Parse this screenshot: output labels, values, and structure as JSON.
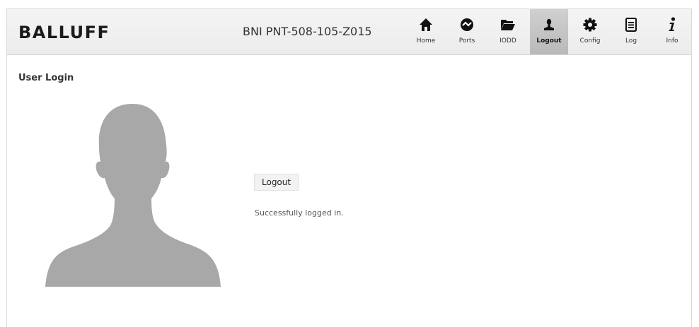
{
  "header": {
    "brand": "BALLUFF",
    "device_name": "BNI PNT-508-105-Z015"
  },
  "nav": [
    {
      "label": "Home",
      "icon": "home-icon"
    },
    {
      "label": "Ports",
      "icon": "ports-icon"
    },
    {
      "label": "IODD",
      "icon": "folder-icon"
    },
    {
      "label": "Logout",
      "icon": "user-icon",
      "active": true
    },
    {
      "label": "Config",
      "icon": "gear-icon"
    },
    {
      "label": "Log",
      "icon": "log-icon"
    },
    {
      "label": "Info",
      "icon": "info-icon"
    }
  ],
  "main": {
    "title": "User Login",
    "logout_button": "Logout",
    "status_message": "Successfully logged in."
  },
  "colors": {
    "header_bg": "#efefef",
    "active_tab_bg": "#c4c4c4",
    "avatar_fill": "#a8a8a8"
  }
}
